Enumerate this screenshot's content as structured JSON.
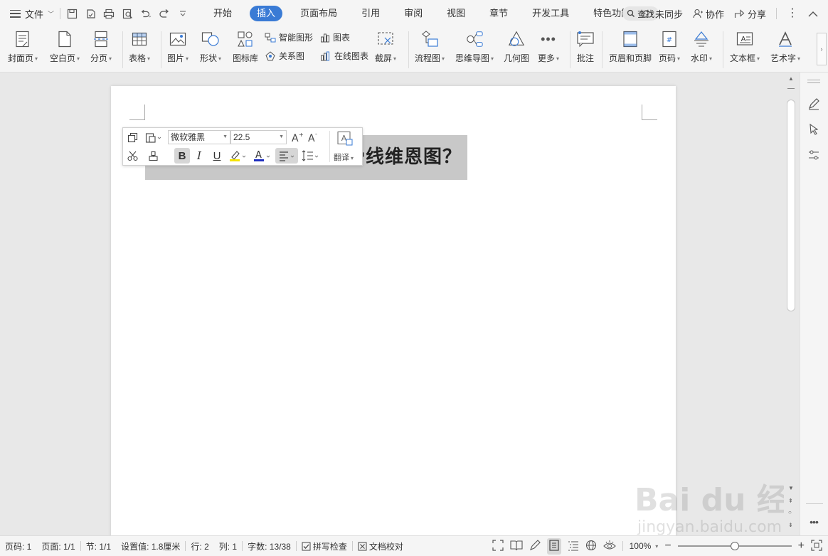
{
  "menu": {
    "file_label": "文件",
    "tabs": [
      "开始",
      "插入",
      "页面布局",
      "引用",
      "审阅",
      "视图",
      "章节",
      "开发工具",
      "特色功能"
    ],
    "active_tab": "插入",
    "search_label": "查找",
    "sync_label": "未同步",
    "collab_label": "协作",
    "share_label": "分享"
  },
  "ribbon": {
    "cover": "封面页",
    "blank": "空白页",
    "pagebreak": "分页",
    "table": "表格",
    "picture": "图片",
    "shape": "形状",
    "iconlib": "图标库",
    "smartart": "智能图形",
    "chart": "图表",
    "relation": "关系图",
    "onlinechart": "在线图表",
    "screenshot": "截屏",
    "flowchart": "流程图",
    "mindmap": "思维导图",
    "geometry": "几何图",
    "more": "更多",
    "comment": "批注",
    "headerfooter": "页眉和页脚",
    "pagenum": "页码",
    "watermark": "水印",
    "textbox": "文本框",
    "wordart": "艺术字"
  },
  "document": {
    "heading_visible": "何绘制树形图、鱼骨线维恩图？"
  },
  "minitoolbar": {
    "font_name": "微软雅黑",
    "font_size": "22.5",
    "bold": "B",
    "italic": "I",
    "underline": "U",
    "translate": "翻译"
  },
  "status": {
    "page_code": "页码: 1",
    "pages": "页面: 1/1",
    "section": "节: 1/1",
    "setting": "设置值: 1.8厘米",
    "row": "行: 2",
    "col": "列: 1",
    "wordcount": "字数: 13/38",
    "spellcheck": "拼写检查",
    "proofread": "文档校对",
    "zoom": "100%",
    "zoom_fraction": 0.5
  },
  "watermark_site": "jingyan.baidu.com",
  "watermark_brand": "Bai du 经验"
}
